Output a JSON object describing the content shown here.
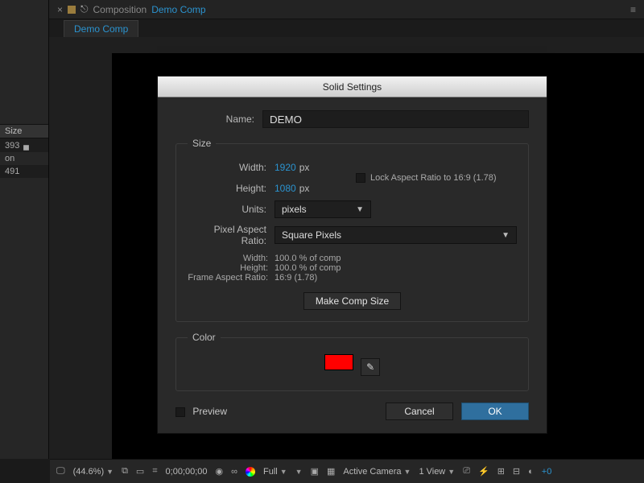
{
  "topbar": {
    "panel_label": "Composition",
    "comp_name": "Demo Comp"
  },
  "tab": {
    "label": "Demo Comp"
  },
  "leftcol": {
    "size_header": "Size",
    "row1": "393",
    "row2": "on",
    "row3": "491"
  },
  "dialog": {
    "title": "Solid Settings",
    "name_label": "Name:",
    "name_value": "DEMO",
    "size_legend": "Size",
    "width_label": "Width:",
    "width_value": "1920",
    "height_label": "Height:",
    "height_value": "1080",
    "px": "px",
    "lock_label": "Lock Aspect Ratio to 16:9 (1.78)",
    "units_label": "Units:",
    "units_value": "pixels",
    "par_label": "Pixel Aspect Ratio:",
    "par_value": "Square Pixels",
    "info_width_label": "Width:",
    "info_width_val": "100.0 % of comp",
    "info_height_label": "Height:",
    "info_height_val": "100.0 % of comp",
    "info_far_label": "Frame Aspect Ratio:",
    "info_far_val": "16:9 (1.78)",
    "make_comp": "Make Comp Size",
    "color_legend": "Color",
    "color_hex": "#ff0000",
    "preview_label": "Preview",
    "cancel": "Cancel",
    "ok": "OK"
  },
  "viewer": {
    "zoom": "(44.6%)",
    "timecode": "0;00;00;00",
    "res": "Full",
    "camera": "Active Camera",
    "view": "1 View",
    "plus": "+0"
  }
}
